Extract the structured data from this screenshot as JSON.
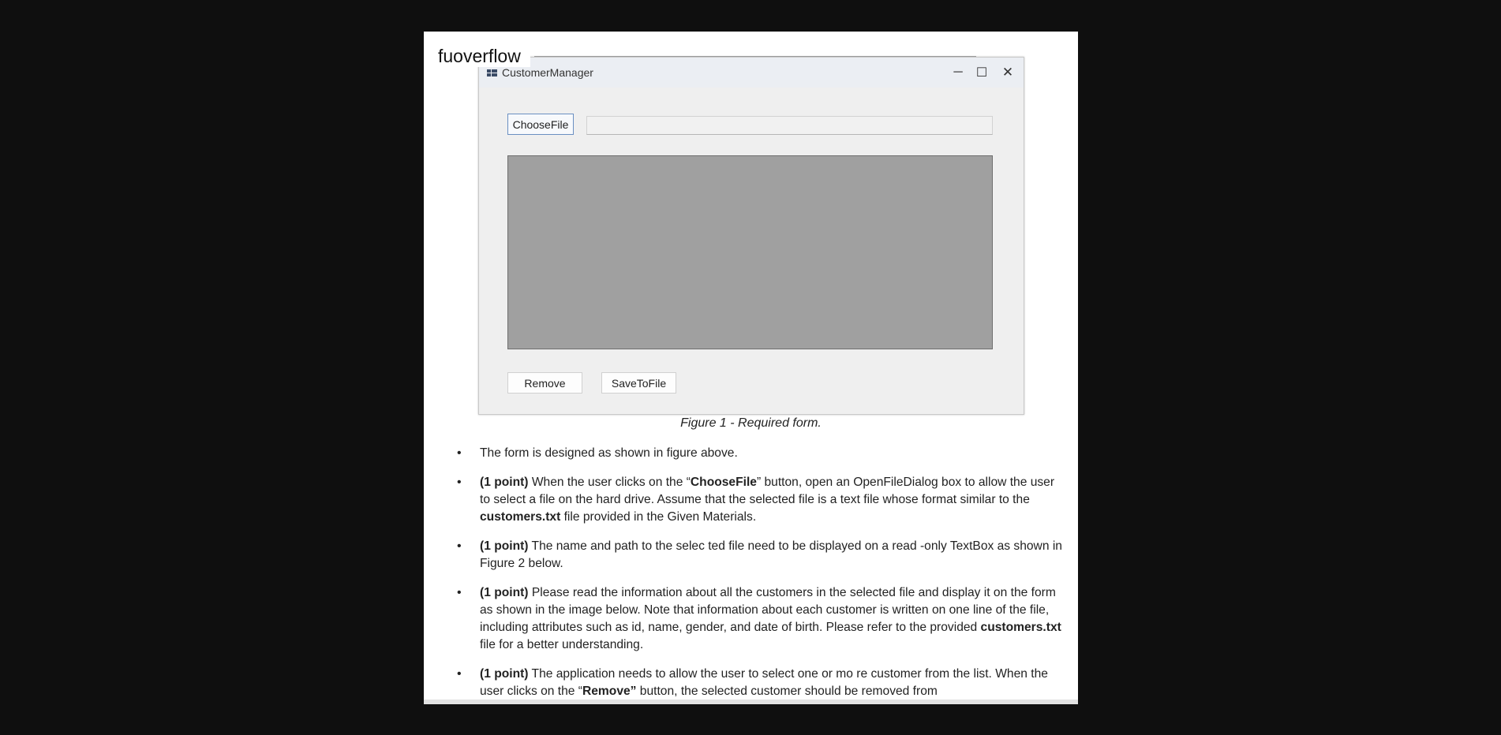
{
  "site": {
    "label": "fuoverflow"
  },
  "form": {
    "title": "CustomerManager",
    "controls": {
      "minimize": "─",
      "maximize": "☐",
      "close": "✕"
    },
    "choose_file_label": "ChooseFile",
    "path_value": "",
    "remove_label": "Remove",
    "save_label": "SaveToFile"
  },
  "figure": {
    "caption": "Figure 1 - Required form."
  },
  "bullets": [
    [
      {
        "t": "The form is designed as shown in figure above."
      }
    ],
    [
      {
        "t": "(1 point)",
        "b": true
      },
      {
        "t": " When the user clicks on the  “"
      },
      {
        "t": "ChooseFile",
        "b": true
      },
      {
        "t": "” button, open an OpenFileDialog box to allow the user to select a file on the hard drive. Assume that the selected file is a   text file whose format similar to the "
      },
      {
        "t": "customers.txt",
        "b": true
      },
      {
        "t": " file provided in the Given Materials."
      }
    ],
    [
      {
        "t": "(1 point)",
        "b": true
      },
      {
        "t": " The name and path to the selec ted file need to be displayed on a read -only TextBox as shown in Figure 2 below."
      }
    ],
    [
      {
        "t": "(1 point)",
        "b": true
      },
      {
        "t": " Please read the information about all the  customers in the selected file and display it on the form as shown in the image below. Note that information about each     customer is written on one line of the file, including attributes such as  id, name, gender, and date of birth. Please refer to the provided "
      },
      {
        "t": "customers.txt",
        "b": true
      },
      {
        "t": " file for a better understanding."
      }
    ],
    [
      {
        "t": "(1 point)",
        "b": true
      },
      {
        "t": "  The application  needs to allow the user to select one or mo    re customer from the list. When the user clicks on the   “"
      },
      {
        "t": "Remove”",
        "b": true
      },
      {
        "t": " button, the selected  customer should be removed from"
      }
    ]
  ]
}
